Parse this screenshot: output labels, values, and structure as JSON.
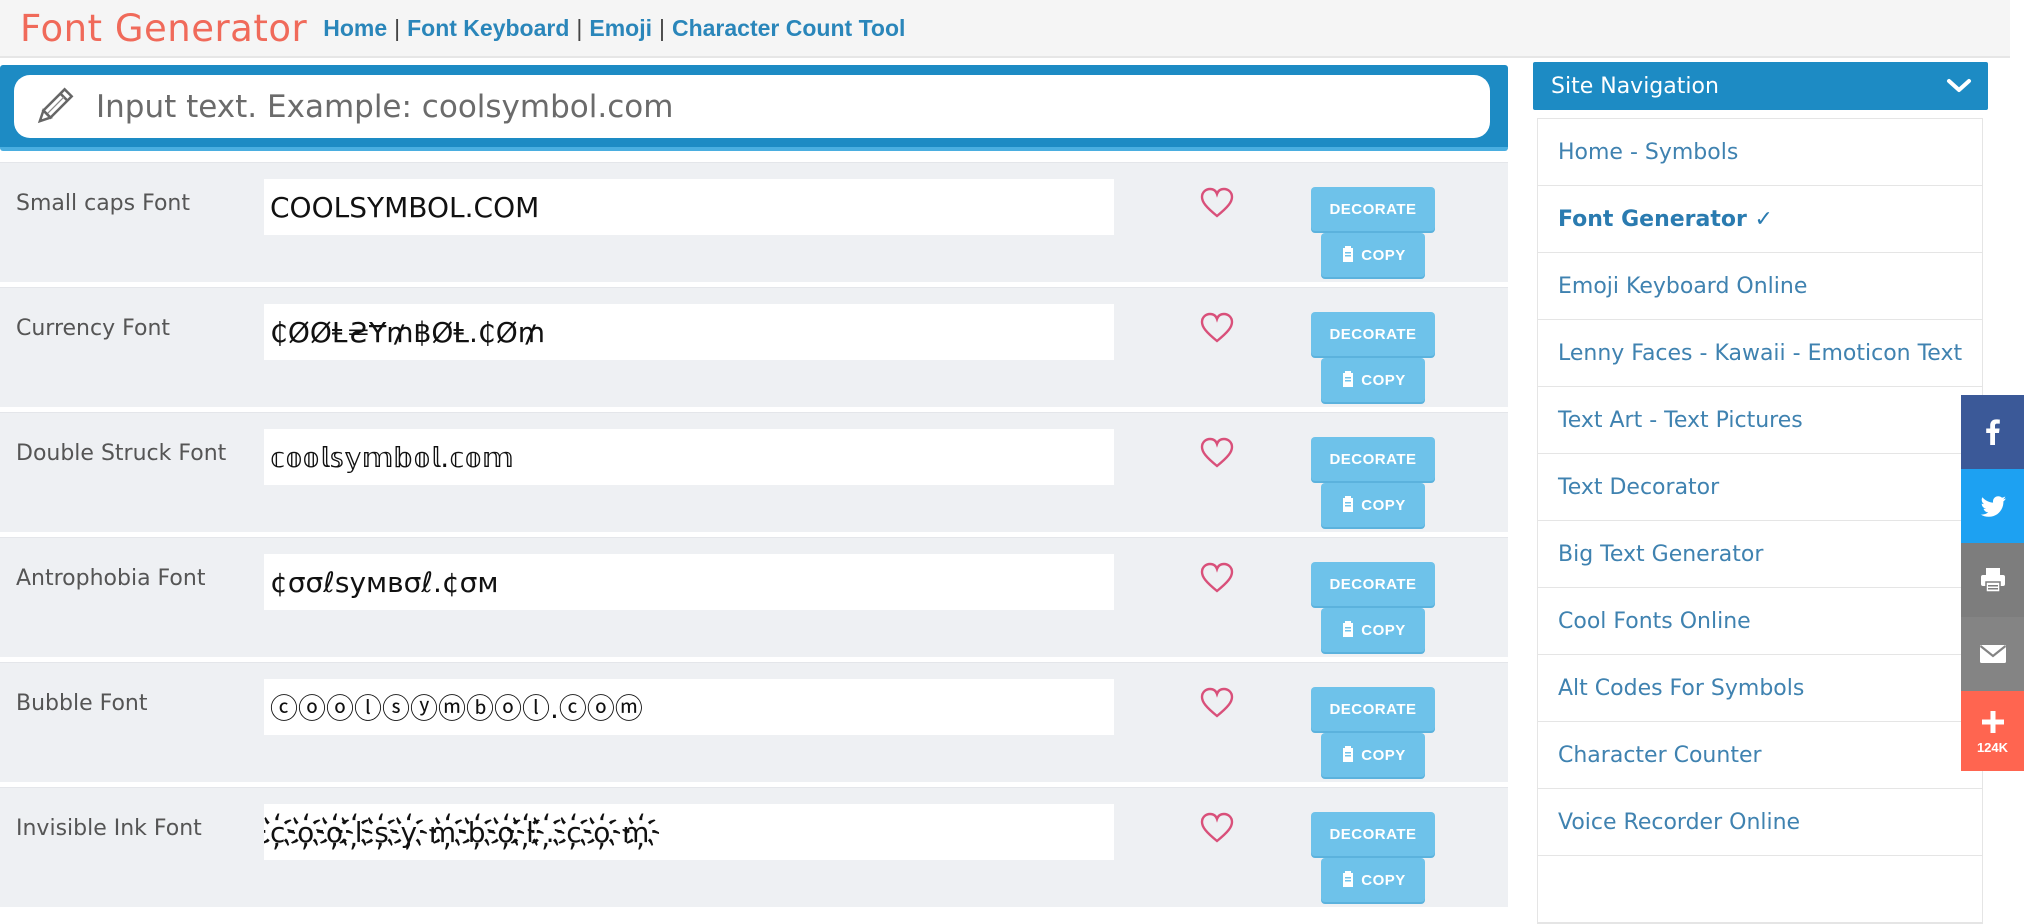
{
  "header": {
    "brand": "Font Generator",
    "links": [
      {
        "label": "Home"
      },
      {
        "label": "Font Keyboard"
      },
      {
        "label": "Emoji"
      },
      {
        "label": "Character Count Tool"
      }
    ],
    "separator": "|"
  },
  "input": {
    "placeholder": "Input text. Example: coolsymbol.com",
    "value": ""
  },
  "rows": [
    {
      "name": "Small caps Font",
      "output": "COOLSYMBOL.COM"
    },
    {
      "name": "Currency Font",
      "output": "₵ØØⱠ₴Ɏ₥฿ØⱠ.₵Ø₥"
    },
    {
      "name": "Double Struck Font",
      "output": "𝕔𝕠𝕠𝕝𝕤𝕪𝕞𝕓𝕠𝕝.𝕔𝕠𝕞"
    },
    {
      "name": "Antrophobia Font",
      "output": "¢σσℓѕумвσℓ.¢σм"
    },
    {
      "name": "Bubble Font",
      "output": "ⓒⓞⓞⓛⓢⓨⓜⓑⓞⓛ.ⓒⓞⓜ"
    },
    {
      "name": "Invisible Ink Font",
      "output": "c҉o҉o҉l҉s҉y҉m҉b҉o҉l҉.҉c҉o҉m҉"
    }
  ],
  "buttons": {
    "decorate": "DECORATE",
    "copy": "COPY"
  },
  "sidebar": {
    "title": "Site Navigation",
    "items": [
      {
        "label": "Home - Symbols"
      },
      {
        "label": "Font Generator ✓"
      },
      {
        "label": "Emoji Keyboard Online"
      },
      {
        "label": "Lenny Faces - Kawaii - Emoticon Text"
      },
      {
        "label": "Text Art - Text Pictures"
      },
      {
        "label": "Text Decorator"
      },
      {
        "label": "Big Text Generator"
      },
      {
        "label": "Cool Fonts Online"
      },
      {
        "label": "Alt Codes For Symbols"
      },
      {
        "label": "Character Counter"
      },
      {
        "label": "Voice Recorder Online"
      },
      {
        "label": ""
      }
    ]
  },
  "share": {
    "buttons": [
      {
        "icon": "facebook-icon"
      },
      {
        "icon": "twitter-icon"
      },
      {
        "icon": "print-icon"
      },
      {
        "icon": "email-icon"
      },
      {
        "icon": "plus-icon",
        "count": "124K"
      }
    ]
  },
  "colors": {
    "brand": "#f06a5a",
    "link": "#2a86ba",
    "primary_blue": "#1d8bc4",
    "button": "#6ec2ea",
    "heart": "#d9507a"
  }
}
